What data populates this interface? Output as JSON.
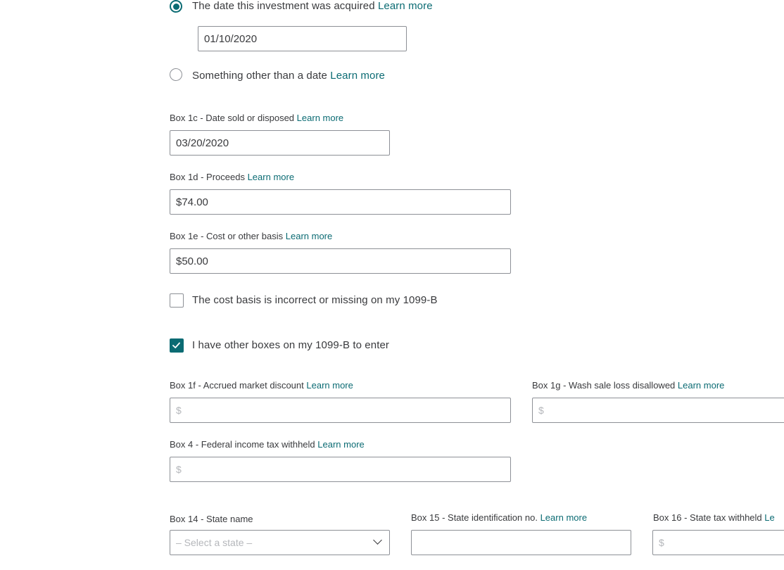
{
  "acquired_group": {
    "option_date_text": "The date this investment was acquired",
    "option_date_link": "Learn more",
    "acquired_date_value": "01/10/2020",
    "option_other_text": "Something other than a date",
    "option_other_link": "Learn more"
  },
  "box1c": {
    "label": "Box 1c - Date sold or disposed",
    "link": "Learn more",
    "value": "03/20/2020"
  },
  "box1d": {
    "label": "Box 1d - Proceeds",
    "link": "Learn more",
    "value": "$74.00"
  },
  "box1e": {
    "label": "Box 1e - Cost or other basis",
    "link": "Learn more",
    "value": "$50.00"
  },
  "cost_basis_checkbox": {
    "label": "The cost basis is incorrect or missing on my 1099-B",
    "checked": false
  },
  "other_boxes_checkbox": {
    "label": "I have other boxes on my 1099-B to enter",
    "checked": true
  },
  "box1f": {
    "label": "Box 1f - Accrued market discount",
    "link": "Learn more",
    "placeholder": "$"
  },
  "box1g": {
    "label": "Box 1g - Wash sale loss disallowed",
    "link": "Learn more",
    "placeholder": "$"
  },
  "box4": {
    "label": "Box 4 - Federal income tax withheld",
    "link": "Learn more",
    "placeholder": "$"
  },
  "box14": {
    "label": "Box 14 - State name",
    "placeholder": "– Select a state –"
  },
  "box15": {
    "label": "Box 15 - State identification no.",
    "link": "Learn more",
    "value": ""
  },
  "box16": {
    "label": "Box 16 - State tax withheld",
    "link": "Le",
    "placeholder": "$"
  },
  "colors": {
    "accent": "#0b6b73",
    "border": "#8d9096",
    "text": "#393a3d",
    "placeholder": "#b5b7bb"
  }
}
